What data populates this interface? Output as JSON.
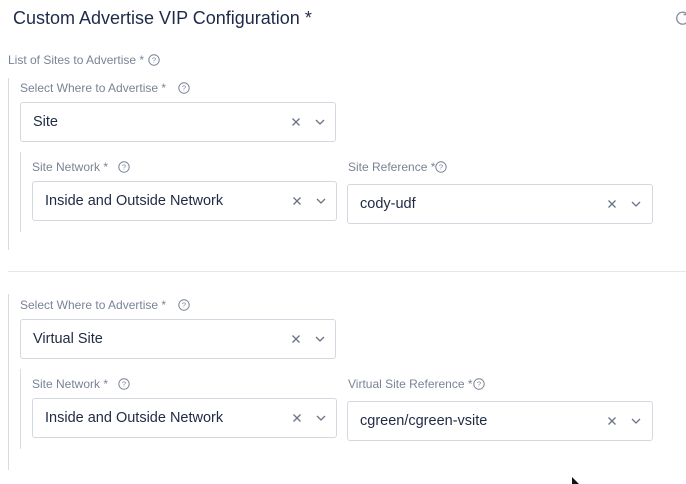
{
  "page": {
    "title": "Custom Advertise VIP Configuration *",
    "list_label": "List of Sites to Advertise *"
  },
  "entries": [
    {
      "where_label": "Select Where to Advertise *",
      "where_value": "Site",
      "network_label": "Site Network *",
      "network_value": "Inside and Outside Network",
      "reference_label": "Site Reference *",
      "reference_value": "cody-udf"
    },
    {
      "where_label": "Select Where to Advertise *",
      "where_value": "Virtual Site",
      "network_label": "Site Network *",
      "network_value": "Inside and Outside Network",
      "reference_label": "Virtual Site Reference *",
      "reference_value": "cgreen/cgreen-vsite"
    }
  ],
  "icons": {
    "help": "question-circle",
    "clear": "x",
    "dropdown": "chevron-down",
    "refresh": "refresh"
  },
  "colors": {
    "text": "#1f2a44",
    "label": "#7a8396",
    "border": "#d4d8e0"
  }
}
